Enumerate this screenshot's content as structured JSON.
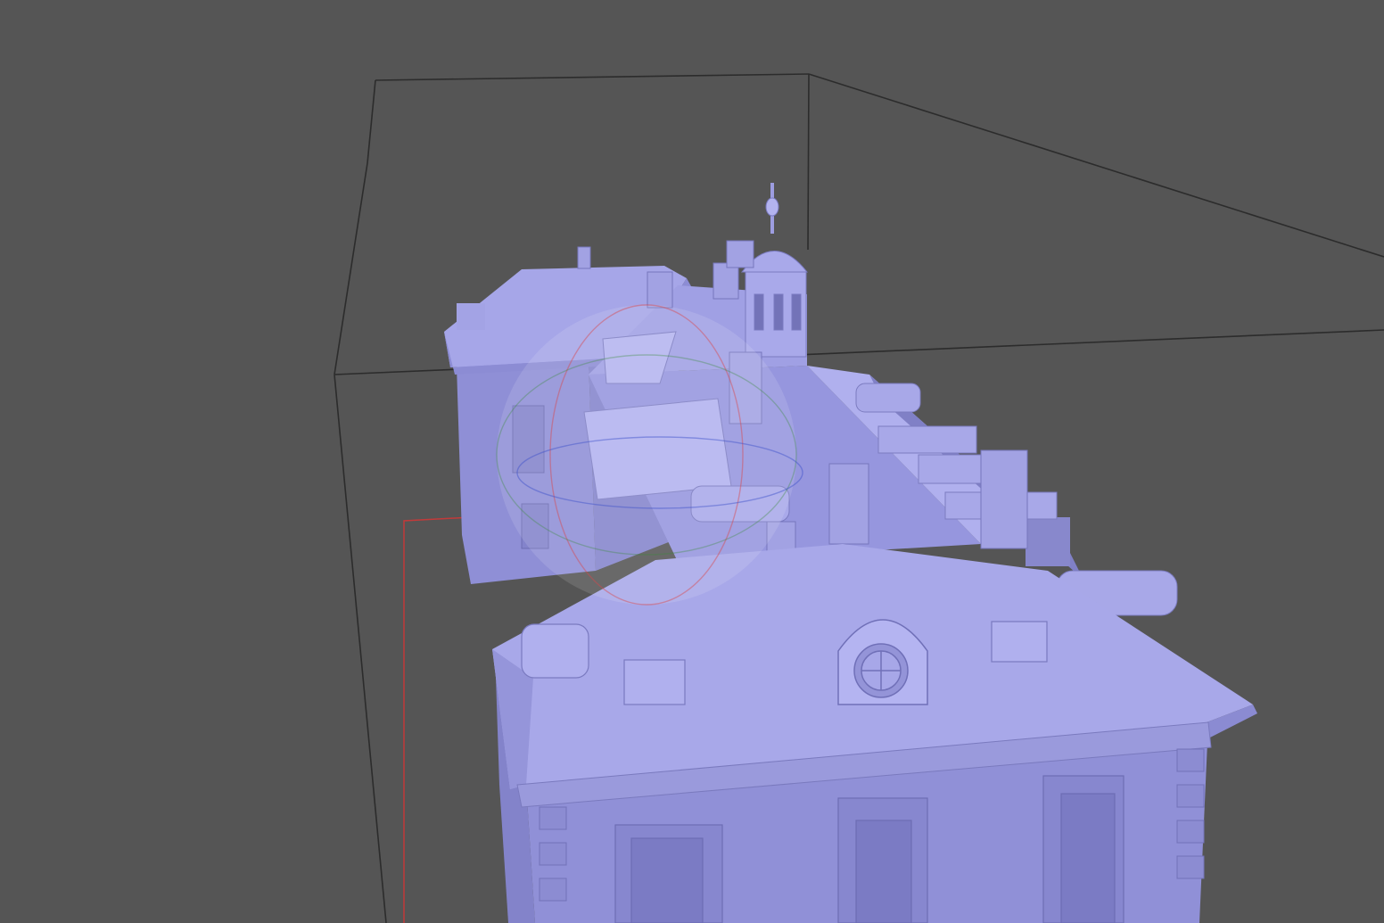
{
  "viewport": {
    "background": "#555555",
    "bounding_box_color": "#2c2c2c",
    "mesh_color": "#9e9ee6",
    "mesh_highlight": "#c3c3f3",
    "mesh_shadow": "#7777bb",
    "selection_color": "#c23a3a"
  },
  "object": {
    "name_icon": "building-mesh",
    "style": "solid grey-violet shading, no textures"
  },
  "gizmo": {
    "type": "trackball",
    "ring_colors": [
      "#d9464b",
      "#3d8b3d",
      "#3b4fc9"
    ]
  }
}
